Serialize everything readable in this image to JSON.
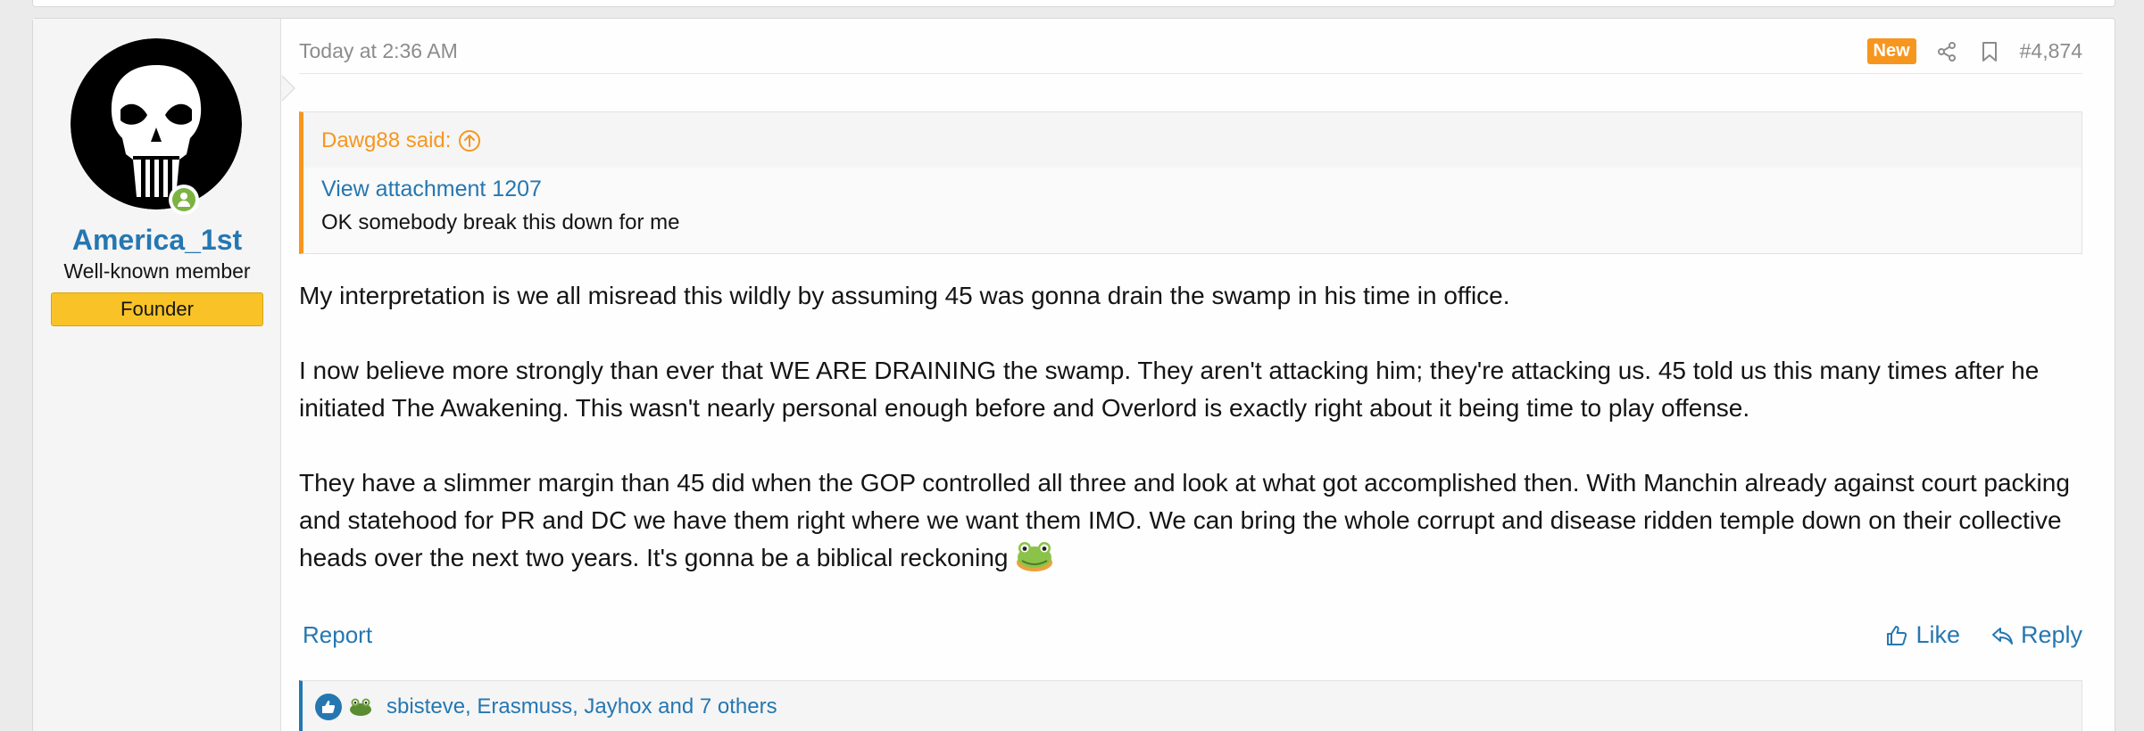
{
  "post": {
    "timestamp": "Today at 2:36 AM",
    "new_badge": "New",
    "post_number": "#4,874",
    "user": {
      "username": "America_1st",
      "title": "Well-known member",
      "banner": "Founder"
    },
    "quote": {
      "author": "Dawg88 said:",
      "attachment_link": "View attachment 1207",
      "text": "OK somebody break this down for me"
    },
    "message": {
      "paragraphs": [
        "My interpretation is we all misread this wildly by assuming 45 was gonna drain the swamp in his time in office.",
        "I now believe more strongly than ever that WE ARE DRAINING the swamp. They aren't attacking him; they're attacking us. 45 told us this many times after he initiated The Awakening. This wasn't nearly personal enough before and Overlord is exactly right about it being time to play offense.",
        "They have a slimmer margin than 45 did when the GOP controlled all three and look at what got accomplished then. With Manchin already against court packing and statehood for PR and DC we have them right where we want them IMO. We can bring the whole corrupt and disease ridden temple down on their collective heads over the next two years. It's gonna be a biblical reckoning"
      ],
      "emoji": "frog-emoji"
    },
    "footer": {
      "report": "Report",
      "like": "Like",
      "reply": "Reply"
    },
    "reactions": {
      "users": [
        "sbisteve",
        "Erasmuss",
        "Jayhox"
      ],
      "separator": ", ",
      "and_others": "and 7 others"
    }
  },
  "colors": {
    "link": "#2577b1",
    "quote_accent": "#f7961e",
    "new_badge": "#f7961e",
    "banner": "#f9c328",
    "online": "#7cb342"
  },
  "icons": [
    "share-icon",
    "bookmark-icon",
    "thumbs-up-icon",
    "reply-icon",
    "quote-jump-icon",
    "online-icon",
    "avatar-punisher-skull"
  ]
}
